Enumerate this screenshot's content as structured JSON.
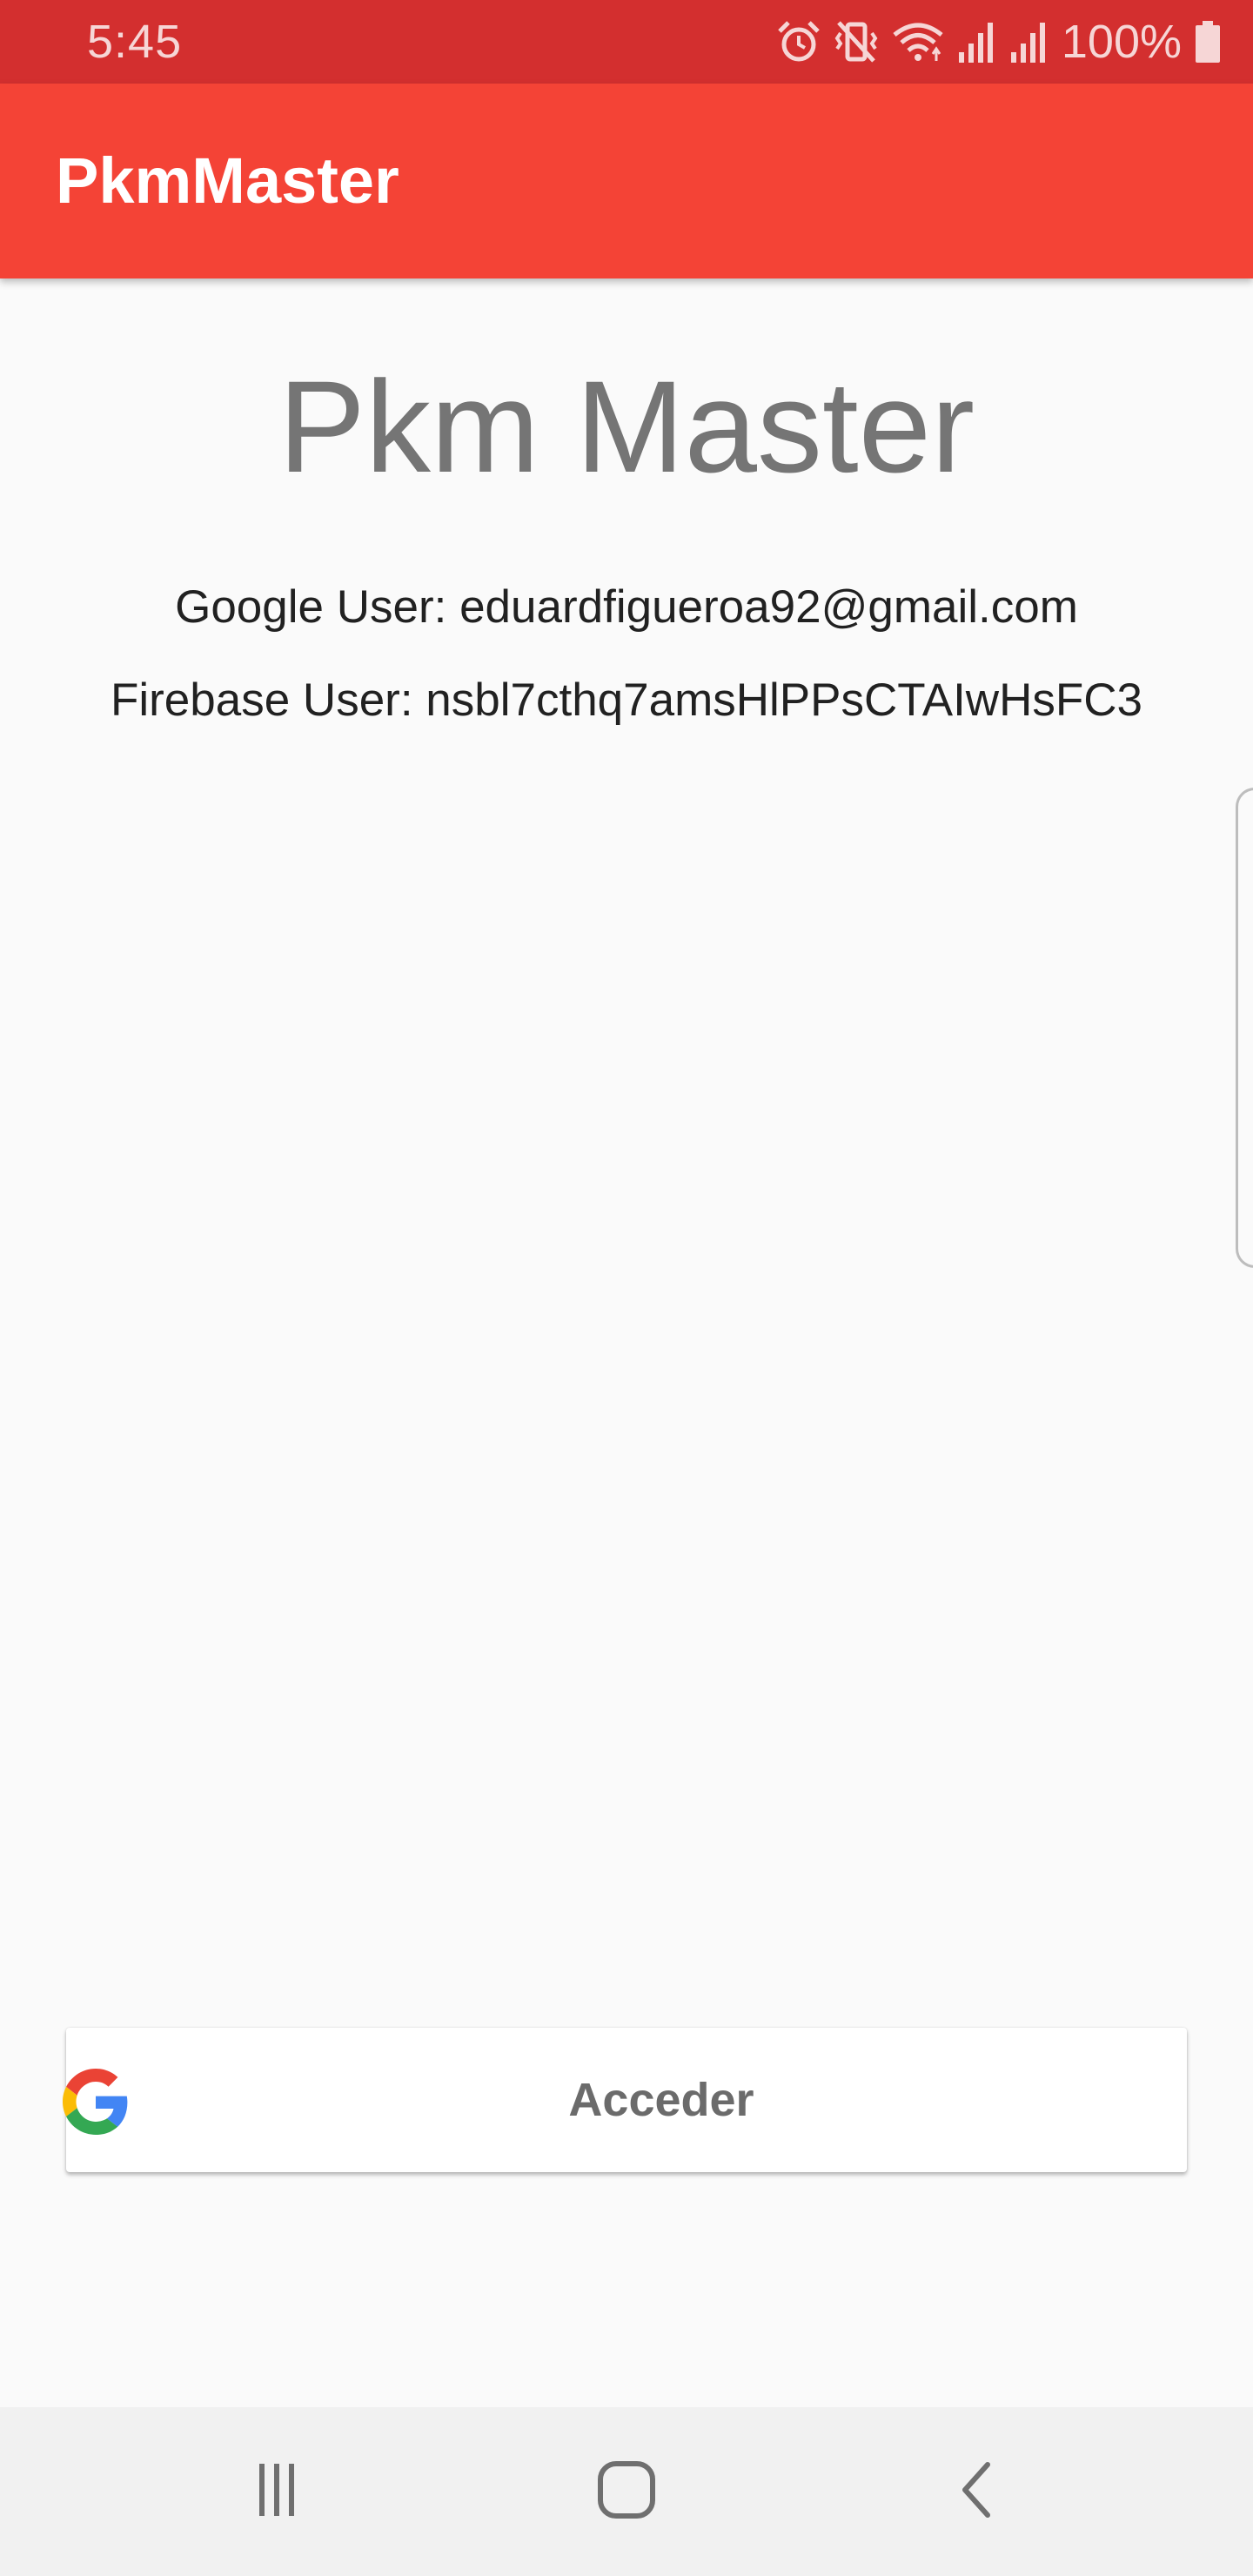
{
  "status_bar": {
    "time": "5:45",
    "battery": "100%",
    "icons": [
      "alarm-icon",
      "vibrate-icon",
      "wifi-icon",
      "signal-icon",
      "signal-icon",
      "battery-icon"
    ]
  },
  "app_bar": {
    "title": "PkmMaster"
  },
  "main": {
    "heading": "Pkm Master",
    "google_user": "Google User: eduardfigueroa92@gmail.com",
    "firebase_user": "Firebase User: nsbl7cthq7amsHlPPsCTAIwHsFC3"
  },
  "sign_in_button": {
    "label": "Acceder",
    "icon": "google-logo-icon"
  },
  "nav_bar": {
    "buttons": [
      "recents-icon",
      "home-icon",
      "back-icon"
    ]
  },
  "colors": {
    "status_bar": "#d32f2f",
    "app_bar": "#f44336",
    "background": "#fafafa",
    "heading_text": "#757575",
    "nav_bar": "#f1f1f1"
  }
}
